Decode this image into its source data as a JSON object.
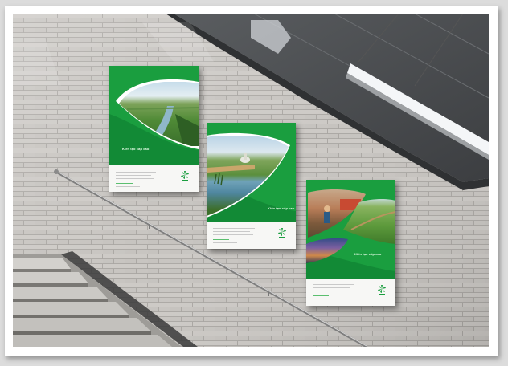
{
  "scene": {
    "colors": {
      "tile": "#c7c4c0",
      "grout": "#a9a6a2",
      "ceiling": "#4a4c4f",
      "light": "#f4f6f8",
      "stairs": "#b9b7b3",
      "brand_green": "#1a9e3f"
    }
  },
  "posters": [
    {
      "headline": "Kiến tạo cấp cao"
    },
    {
      "headline": "Kiến tạo cấp cao"
    },
    {
      "headline": "Kiến tạo cấp cao"
    }
  ],
  "icons": {
    "logo": "pinwheel-logo-icon",
    "handrail": "handrail",
    "lamp": "ceiling-light-icon"
  }
}
